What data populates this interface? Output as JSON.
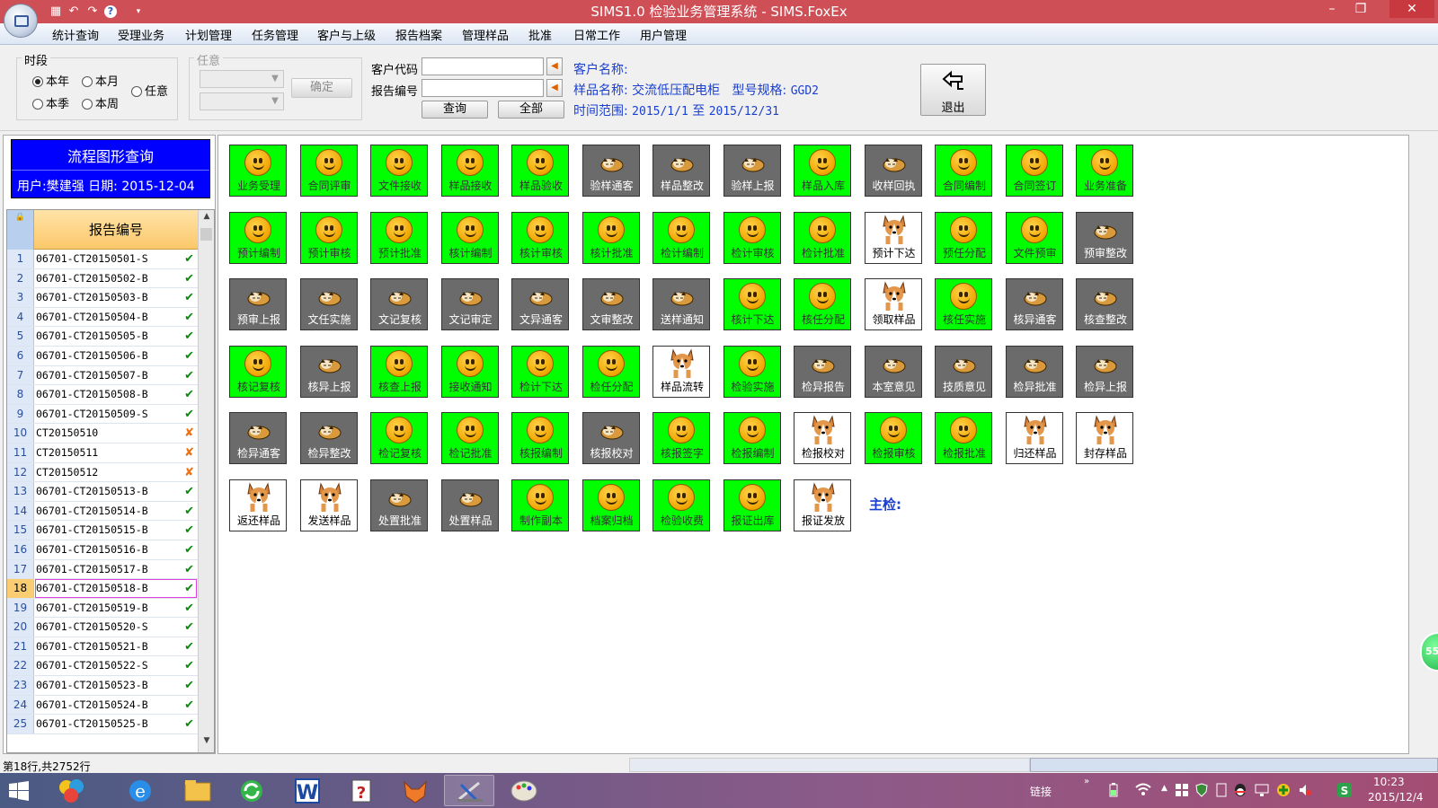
{
  "window": {
    "title": "SIMS1.0 检验业务管理系统 - SIMS.FoxEx",
    "restore_glyph": "❐",
    "close_glyph": "✕",
    "minimize_glyph": "–"
  },
  "menu": [
    "统计查询",
    "受理业务",
    "计划管理",
    "任务管理",
    "客户与上级",
    "报告档案",
    "管理样品",
    "批准",
    "日常工作",
    "用户管理"
  ],
  "filters": {
    "period_label": "时段",
    "radios": [
      "本年",
      "本月",
      "任意",
      "本季",
      "本周"
    ],
    "selected_radio": "本年",
    "arbitrary_label": "任意",
    "confirm_label": "确定",
    "customer_code_label": "客户代码",
    "report_no_label": "报告编号",
    "customer_code_value": "",
    "report_no_value": "",
    "query_label": "查询",
    "all_label": "全部",
    "exit_label": "退出"
  },
  "info": {
    "customer_label": "客户名称:",
    "customer_value": "",
    "sample_label": "样品名称:",
    "sample_value": "交流低压配电柜",
    "model_label": "型号规格:",
    "model_value": "GGD2",
    "time_label": "时间范围:",
    "time_start": "2015/1/1",
    "time_to": "至",
    "time_end": "2015/12/31"
  },
  "left": {
    "flow_title": "流程图形查询",
    "user_line": "用户:樊建强  日期: 2015-12-04",
    "grid_header": "报告编号",
    "selected_row": 18,
    "rows": [
      {
        "n": "1",
        "code": "06701-CT20150501-S",
        "ok": true
      },
      {
        "n": "2",
        "code": "06701-CT20150502-B",
        "ok": true
      },
      {
        "n": "3",
        "code": "06701-CT20150503-B",
        "ok": true
      },
      {
        "n": "4",
        "code": "06701-CT20150504-B",
        "ok": true
      },
      {
        "n": "5",
        "code": "06701-CT20150505-B",
        "ok": true
      },
      {
        "n": "6",
        "code": "06701-CT20150506-B",
        "ok": true
      },
      {
        "n": "7",
        "code": "06701-CT20150507-B",
        "ok": true
      },
      {
        "n": "8",
        "code": "06701-CT20150508-B",
        "ok": true
      },
      {
        "n": "9",
        "code": "06701-CT20150509-S",
        "ok": true
      },
      {
        "n": "10",
        "code": "CT20150510",
        "ok": false
      },
      {
        "n": "11",
        "code": "CT20150511",
        "ok": false
      },
      {
        "n": "12",
        "code": "CT20150512",
        "ok": false
      },
      {
        "n": "13",
        "code": "06701-CT20150513-B",
        "ok": true
      },
      {
        "n": "14",
        "code": "06701-CT20150514-B",
        "ok": true
      },
      {
        "n": "15",
        "code": "06701-CT20150515-B",
        "ok": true
      },
      {
        "n": "16",
        "code": "06701-CT20150516-B",
        "ok": true
      },
      {
        "n": "17",
        "code": "06701-CT20150517-B",
        "ok": true
      },
      {
        "n": "18",
        "code": "06701-CT20150518-B",
        "ok": true
      },
      {
        "n": "19",
        "code": "06701-CT20150519-B",
        "ok": true
      },
      {
        "n": "20",
        "code": "06701-CT20150520-S",
        "ok": true
      },
      {
        "n": "21",
        "code": "06701-CT20150521-B",
        "ok": true
      },
      {
        "n": "22",
        "code": "06701-CT20150522-S",
        "ok": true
      },
      {
        "n": "23",
        "code": "06701-CT20150523-B",
        "ok": true
      },
      {
        "n": "24",
        "code": "06701-CT20150524-B",
        "ok": true
      },
      {
        "n": "25",
        "code": "06701-CT20150525-B",
        "ok": true
      }
    ]
  },
  "tiles": [
    [
      {
        "l": "业务受理",
        "s": "g"
      },
      {
        "l": "合同评审",
        "s": "g"
      },
      {
        "l": "文件接收",
        "s": "g"
      },
      {
        "l": "样品接收",
        "s": "g"
      },
      {
        "l": "样品验收",
        "s": "g"
      },
      {
        "l": "验样通客",
        "s": "d"
      },
      {
        "l": "样品整改",
        "s": "d"
      },
      {
        "l": "验样上报",
        "s": "d"
      },
      {
        "l": "样品入库",
        "s": "g"
      },
      {
        "l": "收样回执",
        "s": "d"
      },
      {
        "l": "合同编制",
        "s": "g"
      },
      {
        "l": "合同签订",
        "s": "g"
      },
      {
        "l": "业务准备",
        "s": "g"
      }
    ],
    [
      {
        "l": "预计编制",
        "s": "g"
      },
      {
        "l": "预计审核",
        "s": "g"
      },
      {
        "l": "预计批准",
        "s": "g"
      },
      {
        "l": "核计编制",
        "s": "g"
      },
      {
        "l": "核计审核",
        "s": "g"
      },
      {
        "l": "核计批准",
        "s": "g"
      },
      {
        "l": "检计编制",
        "s": "g"
      },
      {
        "l": "检计审核",
        "s": "g"
      },
      {
        "l": "检计批准",
        "s": "g"
      },
      {
        "l": "预计下达",
        "s": "w"
      },
      {
        "l": "预任分配",
        "s": "g"
      },
      {
        "l": "文件预审",
        "s": "g"
      },
      {
        "l": "预审整改",
        "s": "d"
      }
    ],
    [
      {
        "l": "预审上报",
        "s": "d"
      },
      {
        "l": "文任实施",
        "s": "d"
      },
      {
        "l": "文记复核",
        "s": "d"
      },
      {
        "l": "文记审定",
        "s": "d"
      },
      {
        "l": "文异通客",
        "s": "d"
      },
      {
        "l": "文审整改",
        "s": "d"
      },
      {
        "l": "送样通知",
        "s": "d"
      },
      {
        "l": "核计下达",
        "s": "g"
      },
      {
        "l": "核任分配",
        "s": "g"
      },
      {
        "l": "领取样品",
        "s": "w"
      },
      {
        "l": "核任实施",
        "s": "g"
      },
      {
        "l": "核异通客",
        "s": "d"
      },
      {
        "l": "核查整改",
        "s": "d"
      }
    ],
    [
      {
        "l": "核记复核",
        "s": "g"
      },
      {
        "l": "核异上报",
        "s": "d"
      },
      {
        "l": "核查上报",
        "s": "g"
      },
      {
        "l": "接收通知",
        "s": "g"
      },
      {
        "l": "检计下达",
        "s": "g"
      },
      {
        "l": "检任分配",
        "s": "g"
      },
      {
        "l": "样品流转",
        "s": "w"
      },
      {
        "l": "检验实施",
        "s": "g"
      },
      {
        "l": "检异报告",
        "s": "d"
      },
      {
        "l": "本室意见",
        "s": "d"
      },
      {
        "l": "技质意见",
        "s": "d"
      },
      {
        "l": "检异批准",
        "s": "d"
      },
      {
        "l": "检异上报",
        "s": "d"
      }
    ],
    [
      {
        "l": "检异通客",
        "s": "d"
      },
      {
        "l": "检异整改",
        "s": "d"
      },
      {
        "l": "检记复核",
        "s": "g"
      },
      {
        "l": "检记批准",
        "s": "g"
      },
      {
        "l": "核报编制",
        "s": "g"
      },
      {
        "l": "核报校对",
        "s": "d"
      },
      {
        "l": "核报签字",
        "s": "g"
      },
      {
        "l": "检报编制",
        "s": "g"
      },
      {
        "l": "检报校对",
        "s": "w"
      },
      {
        "l": "检报审核",
        "s": "g"
      },
      {
        "l": "检报批准",
        "s": "g"
      },
      {
        "l": "归还样品",
        "s": "w"
      },
      {
        "l": "封存样品",
        "s": "w"
      }
    ],
    [
      {
        "l": "返还样品",
        "s": "w"
      },
      {
        "l": "发送样品",
        "s": "w"
      },
      {
        "l": "处置批准",
        "s": "d"
      },
      {
        "l": "处置样品",
        "s": "d"
      },
      {
        "l": "制作副本",
        "s": "g"
      },
      {
        "l": "档案归档",
        "s": "g"
      },
      {
        "l": "检验收费",
        "s": "g"
      },
      {
        "l": "报证出库",
        "s": "g"
      },
      {
        "l": "报证发放",
        "s": "w"
      }
    ]
  ],
  "inspector_label": "主检:",
  "status": {
    "text": "第18行,共2752行"
  },
  "badge": "55",
  "tray": {
    "link_label": "链接",
    "time": "10:23",
    "date": "2015/12/4"
  },
  "colors": {
    "titlebar": "#cf4f57",
    "done": "#00ff00",
    "pending": "#6b6b6b",
    "current": "#ffffff",
    "info_text": "#1a3fd0",
    "flow_title_bg": "#0000ff"
  }
}
